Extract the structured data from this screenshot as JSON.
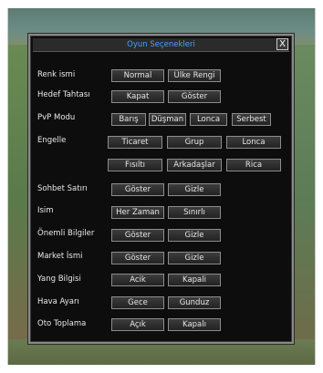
{
  "window": {
    "title": "Oyun Seçenekleri",
    "close_label": "X"
  },
  "rows": {
    "renk_ismi": {
      "label": "Renk ismi",
      "buttons": [
        "Normal",
        "Ülke Rengi"
      ]
    },
    "hedef_tahtasi": {
      "label": "Hedef Tahtası",
      "buttons": [
        "Kapat",
        "Göster"
      ]
    },
    "pvp_modu": {
      "label": "PvP Modu",
      "buttons": [
        "Barış",
        "Düşman",
        "Lonca",
        "Serbest"
      ]
    },
    "engelle": {
      "label": "Engelle",
      "buttons": [
        "Ticaret",
        "Grup",
        "Lonca",
        "Fısıltı",
        "Arkadaşlar",
        "Rica"
      ]
    },
    "sohbet_satiri": {
      "label": "Sohbet Satırı",
      "buttons": [
        "Göster",
        "Gizle"
      ]
    },
    "isim": {
      "label": "Isim",
      "buttons": [
        "Her Zaman",
        "Sınırlı"
      ]
    },
    "onemli_bilgiler": {
      "label": "Önemli Bilgiler",
      "buttons": [
        "Göster",
        "Gizle"
      ]
    },
    "market_ismi": {
      "label": "Market İsmi",
      "buttons": [
        "Göster",
        "Gizle"
      ]
    },
    "yang_bilgisi": {
      "label": "Yang Bilgisi",
      "buttons": [
        "Acik",
        "Kapali"
      ]
    },
    "hava_ayari": {
      "label": "Hava Ayarı",
      "buttons": [
        "Gece",
        "Gunduz"
      ]
    },
    "oto_toplama": {
      "label": "Oto Toplama",
      "buttons": [
        "Açık",
        "Kapalı"
      ]
    }
  }
}
